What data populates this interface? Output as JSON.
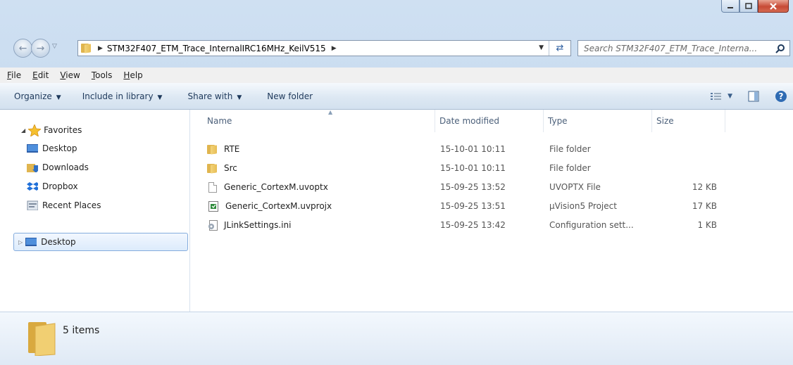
{
  "window": {
    "caption_buttons": [
      "minimize",
      "maximize",
      "close"
    ]
  },
  "address_bar": {
    "breadcrumbs": [
      "STM32F407_ETM_Trace_InternalIRC16MHz_KeilV515"
    ],
    "search_placeholder": "Search STM32F407_ETM_Trace_Interna..."
  },
  "menubar": {
    "items": [
      "File",
      "Edit",
      "View",
      "Tools",
      "Help"
    ]
  },
  "commandbar": {
    "organize": "Organize",
    "include_in_library": "Include in library",
    "share_with": "Share with",
    "new_folder": "New folder"
  },
  "navpane": {
    "favorites_label": "Favorites",
    "favorites": [
      {
        "label": "Desktop",
        "icon": "desktop-icon"
      },
      {
        "label": "Downloads",
        "icon": "downloads-icon"
      },
      {
        "label": "Dropbox",
        "icon": "dropbox-icon"
      },
      {
        "label": "Recent Places",
        "icon": "recent-places-icon"
      }
    ],
    "tree_root": "Desktop"
  },
  "filelist": {
    "columns": {
      "name": "Name",
      "date": "Date modified",
      "type": "Type",
      "size": "Size"
    },
    "rows": [
      {
        "name": "RTE",
        "date": "15-10-01 10:11",
        "type": "File folder",
        "size": "",
        "icon": "folder-icon"
      },
      {
        "name": "Src",
        "date": "15-10-01 10:11",
        "type": "File folder",
        "size": "",
        "icon": "folder-icon"
      },
      {
        "name": "Generic_CortexM.uvoptx",
        "date": "15-09-25 13:52",
        "type": "UVOPTX File",
        "size": "12 KB",
        "icon": "file-icon"
      },
      {
        "name": "Generic_CortexM.uvprojx",
        "date": "15-09-25 13:51",
        "type": "µVision5 Project",
        "size": "17 KB",
        "icon": "uvision-project-icon"
      },
      {
        "name": "JLinkSettings.ini",
        "date": "15-09-25 13:42",
        "type": "Configuration sett...",
        "size": "1 KB",
        "icon": "ini-settings-icon"
      }
    ]
  },
  "details": {
    "item_count": "5 items"
  },
  "colors": {
    "accent": "#1e395b",
    "selection_border": "#84acdd",
    "close_button": "#c74a35"
  }
}
